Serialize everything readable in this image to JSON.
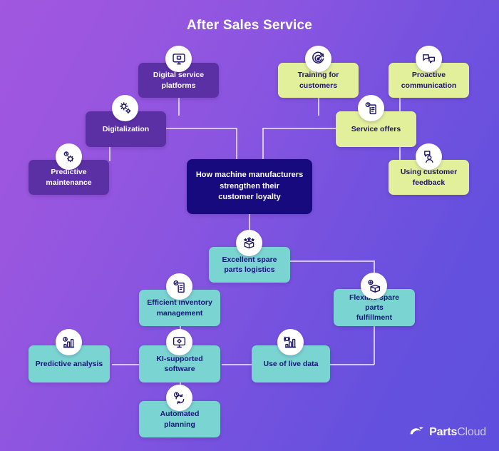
{
  "title": "After Sales Service",
  "colors": {
    "bg_from": "#9a56df",
    "bg_to": "#6150de",
    "node_purple": "#5b30a5",
    "node_navy": "#160a7e",
    "node_lime": "#e2f09b",
    "node_teal": "#7ad4d2",
    "connector": "#e4ddf6",
    "title_text": "#ffffff"
  },
  "center": {
    "label": "How machine manufacturers strengthen their customer loyalty",
    "line1": "How machine manufacturers",
    "line2": "strengthen their",
    "line3": "customer loyalty"
  },
  "nodes": [
    {
      "id": "digital-service-platforms",
      "label": "Digital service platforms",
      "style": "purple",
      "icon": "monitor-icon"
    },
    {
      "id": "digitalization",
      "label": "Digitalization",
      "style": "purple",
      "icon": "gears-icon"
    },
    {
      "id": "predictive-maintenance",
      "label": "Predictive maintenance",
      "style": "purple",
      "icon": "gear-clock-icon"
    },
    {
      "id": "training-for-customers",
      "label": "Training for customers",
      "style": "lime",
      "icon": "target-arrow-icon"
    },
    {
      "id": "service-offers",
      "label": "Service offers",
      "style": "lime",
      "icon": "document-clock-icon"
    },
    {
      "id": "proactive-communication",
      "label": "Proactive communication",
      "style": "lime",
      "icon": "chat-bubbles-icon"
    },
    {
      "id": "using-customer-feedback",
      "label": "Using customer feedback",
      "style": "lime",
      "icon": "feedback-person-icon"
    },
    {
      "id": "excellent-spare-parts-logistics",
      "label": "Excellent spare parts logistics",
      "style": "teal",
      "icon": "box-stars-icon"
    },
    {
      "id": "efficient-inventory-management",
      "label": "Efficient inventory management",
      "style": "teal",
      "icon": "checklist-icon"
    },
    {
      "id": "flexible-spare-parts-fulfillment",
      "label": "Flexible spare parts fulfillment",
      "style": "teal",
      "icon": "box-plus-icon"
    },
    {
      "id": "ki-supported-software",
      "label": "KI-supported software",
      "style": "teal",
      "icon": "monitor-gear-icon"
    },
    {
      "id": "predictive-analysis",
      "label": "Predictive analysis",
      "style": "teal",
      "icon": "chart-clock-icon"
    },
    {
      "id": "use-of-live-data",
      "label": "Use of live data",
      "style": "teal",
      "icon": "chart-live-icon"
    },
    {
      "id": "automated-planning",
      "label": "Automated planning",
      "style": "teal",
      "icon": "clock-refresh-icon"
    }
  ],
  "node_text": {
    "digital_service_platforms_l1": "Digital service",
    "digital_service_platforms_l2": "platforms",
    "digitalization": "Digitalization",
    "predictive_maintenance_l1": "Predictive",
    "predictive_maintenance_l2": "maintenance",
    "training_for_customers_l1": "Training for",
    "training_for_customers_l2": "customers",
    "service_offers": "Service offers",
    "proactive_communication_l1": "Proactive",
    "proactive_communication_l2": "communication",
    "using_customer_feedback_l1": "Using customer",
    "using_customer_feedback_l2": "feedback",
    "excellent_spare_parts_logistics_l1": "Excellent spare",
    "excellent_spare_parts_logistics_l2": "parts logistics",
    "efficient_inventory_management_l1": "Efficient inventory",
    "efficient_inventory_management_l2": "management",
    "flexible_spare_parts_fulfillment_l1": "Flexible spare parts",
    "flexible_spare_parts_fulfillment_l2": "fulfillment",
    "ki_supported_software_l1": "KI-supported",
    "ki_supported_software_l2": "software",
    "predictive_analysis": "Predictive analysis",
    "use_of_live_data": "Use of live data",
    "automated_planning_l1": "Automated",
    "automated_planning_l2": "planning"
  },
  "logo": {
    "name_part1": "Parts",
    "name_part2": "Cloud",
    "mark": "cloud-arrow-icon"
  }
}
